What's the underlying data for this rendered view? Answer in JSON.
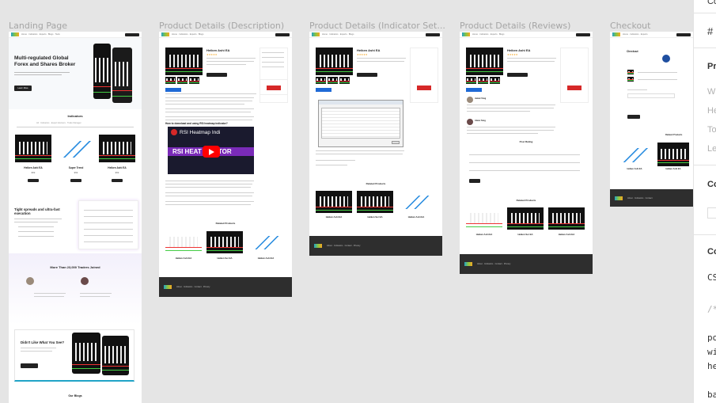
{
  "frames": [
    {
      "label": "Landing Page"
    },
    {
      "label": "Product Details (Description)"
    },
    {
      "label": "Product Details (Indicator Set..."
    },
    {
      "label": "Product Details (Reviews)"
    },
    {
      "label": "Checkout"
    }
  ],
  "landing": {
    "hero_title": "Multi-regulated Global Forex and Shares Broker",
    "hero_button": "Learn More",
    "indicators_heading": "Indicators",
    "products": [
      {
        "name": "Heiken Ashi EA",
        "price": "$59"
      },
      {
        "name": "Super Trend",
        "price": "$59"
      },
      {
        "name": "Heiken Ashi EA",
        "price": "$59"
      }
    ],
    "spreads_title": "Tight spreads and ultra-fast execution",
    "traders_heading": "More Than 23,000 Traders Joined",
    "didnt_like_title": "Didn't Like What You See?",
    "blogs_heading": "Our Blogs"
  },
  "description": {
    "product_title": "Heiken Ashi EA",
    "question": "How to download and using RSI heatmap indicator?",
    "video_title": "RSI Heatmap Indi",
    "video_banner": "RSI HEAT   DICATOR",
    "related_heading": "Related Products",
    "related": [
      "Heiken Ashi EA",
      "Heiken Ser EA",
      "Heiken Ashi EA"
    ]
  },
  "indicator": {
    "product_title": "Heiken Ashi EA",
    "related_heading": "Related Products",
    "related": [
      "Heiken Ashi EA",
      "Heiken Ser EA",
      "Heiken Ashi EA"
    ]
  },
  "reviews": {
    "product_title": "Heiken Ashi EA",
    "reviewers": [
      "Jamal Yang",
      "Alexa Yang"
    ],
    "form_heading": "Post Rating",
    "related_heading": "Related Products",
    "related": [
      "Heiken Ashi EA",
      "Heiken Ser EA",
      "Heiken Ashi EA"
    ]
  },
  "checkout": {
    "title": "Checkout",
    "related_heading": "Related Products",
    "related": [
      "Heiken Ashi EA",
      "Heiken Ashi EA"
    ]
  },
  "right_panel": {
    "header": "Co",
    "hash": "#",
    "props_heading": "Pr",
    "props": [
      "W",
      "He",
      "To",
      "Le"
    ],
    "section2": "Co",
    "section3": "Co",
    "css_label": "CS",
    "comment": "/*",
    "code_lines": [
      "po",
      "wi",
      "he"
    ],
    "code_last": "ba"
  }
}
